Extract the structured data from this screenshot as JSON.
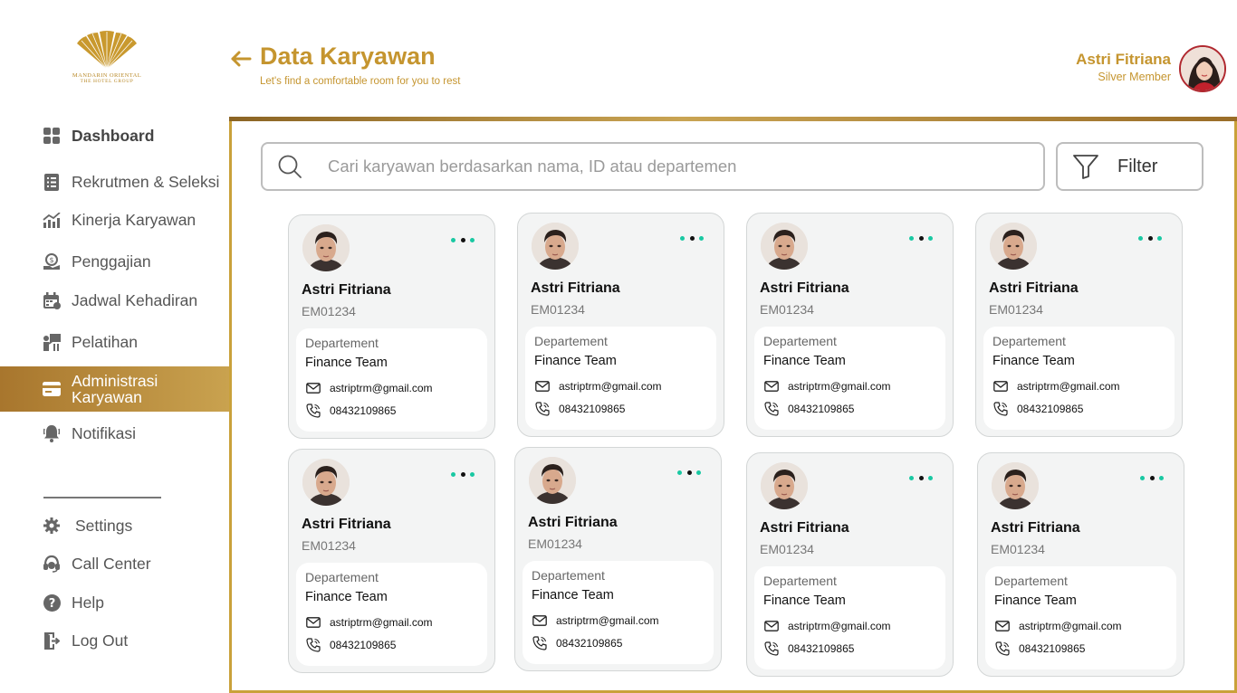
{
  "brand": {
    "line1": "MANDARIN ORIENTAL",
    "line2": "THE HOTEL GROUP",
    "color": "#c5952f"
  },
  "header": {
    "title": "Data Karyawan",
    "subtitle": "Let's find a comfortable room for you to rest",
    "user_name": "Astri Fitriana",
    "user_tier": "Silver Member"
  },
  "sidebar": {
    "items": [
      {
        "label": "Dashboard",
        "icon": "dashboard-grid-icon"
      },
      {
        "label": "Rekrutmen & Seleksi",
        "icon": "document-list-icon"
      },
      {
        "label": "Kinerja Karyawan",
        "icon": "chart-trend-icon"
      },
      {
        "label": "Penggajian",
        "icon": "payroll-icon"
      },
      {
        "label": "Jadwal Kehadiran",
        "icon": "calendar-icon"
      },
      {
        "label": "Pelatihan",
        "icon": "training-icon"
      },
      {
        "label": "Administrasi Karyawan",
        "icon": "id-card-icon",
        "active": true
      },
      {
        "label": "Notifikasi",
        "icon": "bell-icon"
      }
    ],
    "bottom": [
      {
        "label": "Settings",
        "icon": "gear-icon"
      },
      {
        "label": "Call Center",
        "icon": "headset-icon"
      },
      {
        "label": "Help",
        "icon": "help-icon"
      },
      {
        "label": "Log Out",
        "icon": "logout-icon"
      }
    ]
  },
  "search": {
    "placeholder": "Cari karyawan berdasarkan nama, ID atau departemen",
    "filter_label": "Filter"
  },
  "employees": [
    {
      "name": "Astri Fitriana",
      "id": "EM01234",
      "dept_label": "Departement",
      "dept": "Finance Team",
      "email": "astriptrm@gmail.com",
      "phone": "08432109865"
    },
    {
      "name": "Astri Fitriana",
      "id": "EM01234",
      "dept_label": "Departement",
      "dept": "Finance Team",
      "email": "astriptrm@gmail.com",
      "phone": "08432109865"
    },
    {
      "name": "Astri Fitriana",
      "id": "EM01234",
      "dept_label": "Departement",
      "dept": "Finance Team",
      "email": "astriptrm@gmail.com",
      "phone": "08432109865"
    },
    {
      "name": "Astri Fitriana",
      "id": "EM01234",
      "dept_label": "Departement",
      "dept": "Finance Team",
      "email": "astriptrm@gmail.com",
      "phone": "08432109865"
    },
    {
      "name": "Astri Fitriana",
      "id": "EM01234",
      "dept_label": "Departement",
      "dept": "Finance Team",
      "email": "astriptrm@gmail.com",
      "phone": "08432109865"
    },
    {
      "name": "Astri Fitriana",
      "id": "EM01234",
      "dept_label": "Departement",
      "dept": "Finance Team",
      "email": "astriptrm@gmail.com",
      "phone": "08432109865"
    },
    {
      "name": "Astri Fitriana",
      "id": "EM01234",
      "dept_label": "Departement",
      "dept": "Finance Team",
      "email": "astriptrm@gmail.com",
      "phone": "08432109865"
    },
    {
      "name": "Astri Fitriana",
      "id": "EM01234",
      "dept_label": "Departement",
      "dept": "Finance Team",
      "email": "astriptrm@gmail.com",
      "phone": "08432109865"
    }
  ],
  "colors": {
    "accent": "#c5952f",
    "active_nav_start": "#a8762d",
    "active_nav_end": "#c9a24f",
    "dot_teal": "#19c8a2",
    "dot_dark": "#111111"
  }
}
